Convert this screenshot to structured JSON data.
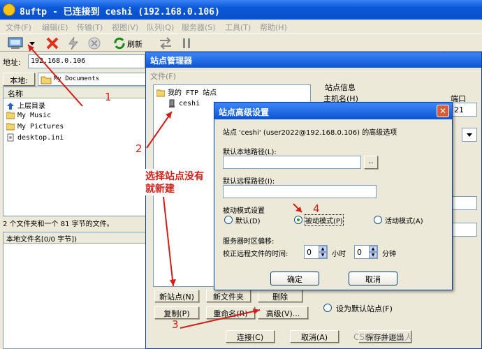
{
  "window": {
    "title": "8uftp - 已连接到 ceshi (192.168.0.106)"
  },
  "menu": [
    "文件(F)",
    "编辑(E)",
    "传输(T)",
    "视图(V)",
    "队列(Q)",
    "服务器(S)",
    "工具(T)",
    "帮助(H)"
  ],
  "toolbar": {
    "refresh_label": "刷新"
  },
  "left_pane": {
    "address_label": "地址:",
    "address_value": "192.168.0.106",
    "local_label": "本地:",
    "local_path": "My Documents",
    "column_name": "名称",
    "items": [
      "上层目录",
      "My Music",
      "My Pictures",
      "desktop.ini"
    ],
    "status": "2 个文件夹和一个 81 字节的文件。",
    "queue_header": "本地文件名[0/0 字节])"
  },
  "site_manager": {
    "title": "站点管理器",
    "menu_file": "文件(F)",
    "tree_root": "我的 FTP 站点",
    "tree_child": "ceshi",
    "site_info": "站点信息",
    "hostname_label": "主机名(H)",
    "port_label": "端口",
    "port_value": "21",
    "buttons": {
      "new_site": "新站点(N)",
      "new_folder": "新文件夹",
      "delete": "删除",
      "copy": "复制(P)",
      "rename": "重命名(R)",
      "advanced": "高级(V)...",
      "connect": "连接(C)",
      "cancel": "取消(A)",
      "save_exit": "保存并退出"
    },
    "default_site": "设为默认站点(F)"
  },
  "advanced_dialog": {
    "title": "站点高级设置",
    "subtitle": "站点 'ceshi' (user2022@192.168.0.106) 的高级选项",
    "local_path_label": "默认本地路径(L):",
    "local_path_value": "",
    "browse": "..",
    "remote_path_label": "默认远程路径(I):",
    "remote_path_value": "",
    "passive_group": "被动模式设置",
    "radio_default": "默认(D)",
    "radio_passive": "被动模式(P)",
    "radio_active": "活动模式(A)",
    "passive_selected": "被动模式(P)",
    "timezone_label": "服务器时区偏移:",
    "adjust_label": "校正远程文件的时间:",
    "hours_value": "0",
    "hours_unit": "小时",
    "minutes_value": "0",
    "minutes_unit": "分钟",
    "ok": "确定",
    "cancel": "取消"
  },
  "annotations": {
    "step1": "1",
    "step2": "2",
    "step3": "3",
    "step4": "4",
    "note_line1": "选择站点没有",
    "note_line2": "就新建",
    "watermark": "CSDN @IT经人"
  },
  "colors": {
    "annotation_red": "#d0201a",
    "title_blue": "#0a58d8"
  }
}
